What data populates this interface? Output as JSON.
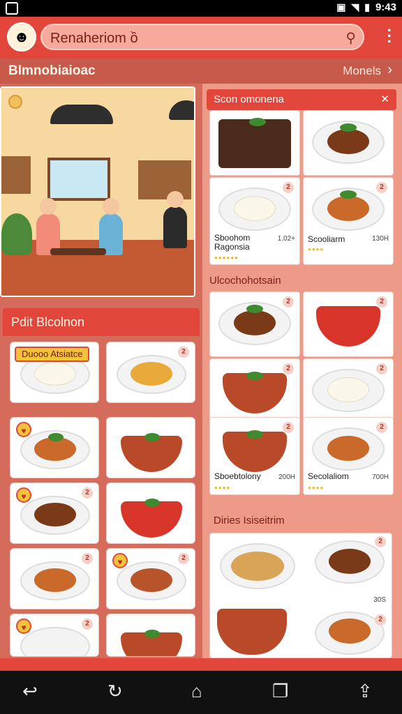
{
  "status_bar": {
    "time": "9:43",
    "icons": [
      "notification-icon",
      "wifi-icon",
      "battery-icon"
    ]
  },
  "header": {
    "search_value": "Renaheriom ồ",
    "search_icon": "search-icon",
    "menu_icon": "kebab-menu-icon",
    "logo_icon": "chef-avatar-icon",
    "colors": {
      "primary": "#e2463a",
      "accent": "#f4c23a"
    }
  },
  "section": {
    "title": "Blmnobiaioac",
    "more": "Monels"
  },
  "left": {
    "section_title": "Pdit Blcolnon",
    "cards": [
      {
        "tag": "Duooo Atsiatce",
        "badge": ""
      },
      {
        "tag": "",
        "badge": "2"
      },
      {
        "tag": "",
        "badge": ""
      },
      {
        "tag": "",
        "badge": ""
      },
      {
        "tag": "",
        "badge": "2"
      },
      {
        "tag": "",
        "badge": ""
      },
      {
        "tag": "",
        "badge": ""
      },
      {
        "tag": "",
        "badge": ""
      },
      {
        "tag": "",
        "badge": "2"
      },
      {
        "tag": "",
        "badge": ""
      }
    ]
  },
  "right": {
    "head_title": "Scon omonena",
    "top_cards": [
      {
        "name": "",
        "price": "",
        "badge": ""
      },
      {
        "name": "",
        "price": "",
        "badge": ""
      },
      {
        "name": "Sboohom\nRagonsia",
        "price": "1.02+",
        "badge": "2"
      },
      {
        "name": "Scooliarm",
        "price": "130H",
        "badge": "2"
      }
    ],
    "section2_title": "Ulcochohotsain",
    "mid_cards": [
      {
        "name": "",
        "price": "",
        "badge": "2"
      },
      {
        "name": "",
        "price": "",
        "badge": "2"
      },
      {
        "name": "",
        "price": "",
        "badge": "2"
      },
      {
        "name": "",
        "price": "",
        "badge": "2"
      },
      {
        "name": "Sboebtolony",
        "price": "200H",
        "badge": "2"
      },
      {
        "name": "Secolaliom",
        "price": "700H",
        "badge": "2"
      }
    ],
    "section3_title": "Diries Isiseitrim",
    "bottom_cards": [
      {
        "badge": ""
      },
      {
        "badge": "2",
        "price": "30S"
      },
      {
        "badge": ""
      },
      {
        "badge": "2"
      }
    ]
  },
  "nav": {
    "buttons": [
      "back-icon",
      "rotate-icon",
      "home-icon",
      "recents-icon",
      "share-icon"
    ]
  }
}
